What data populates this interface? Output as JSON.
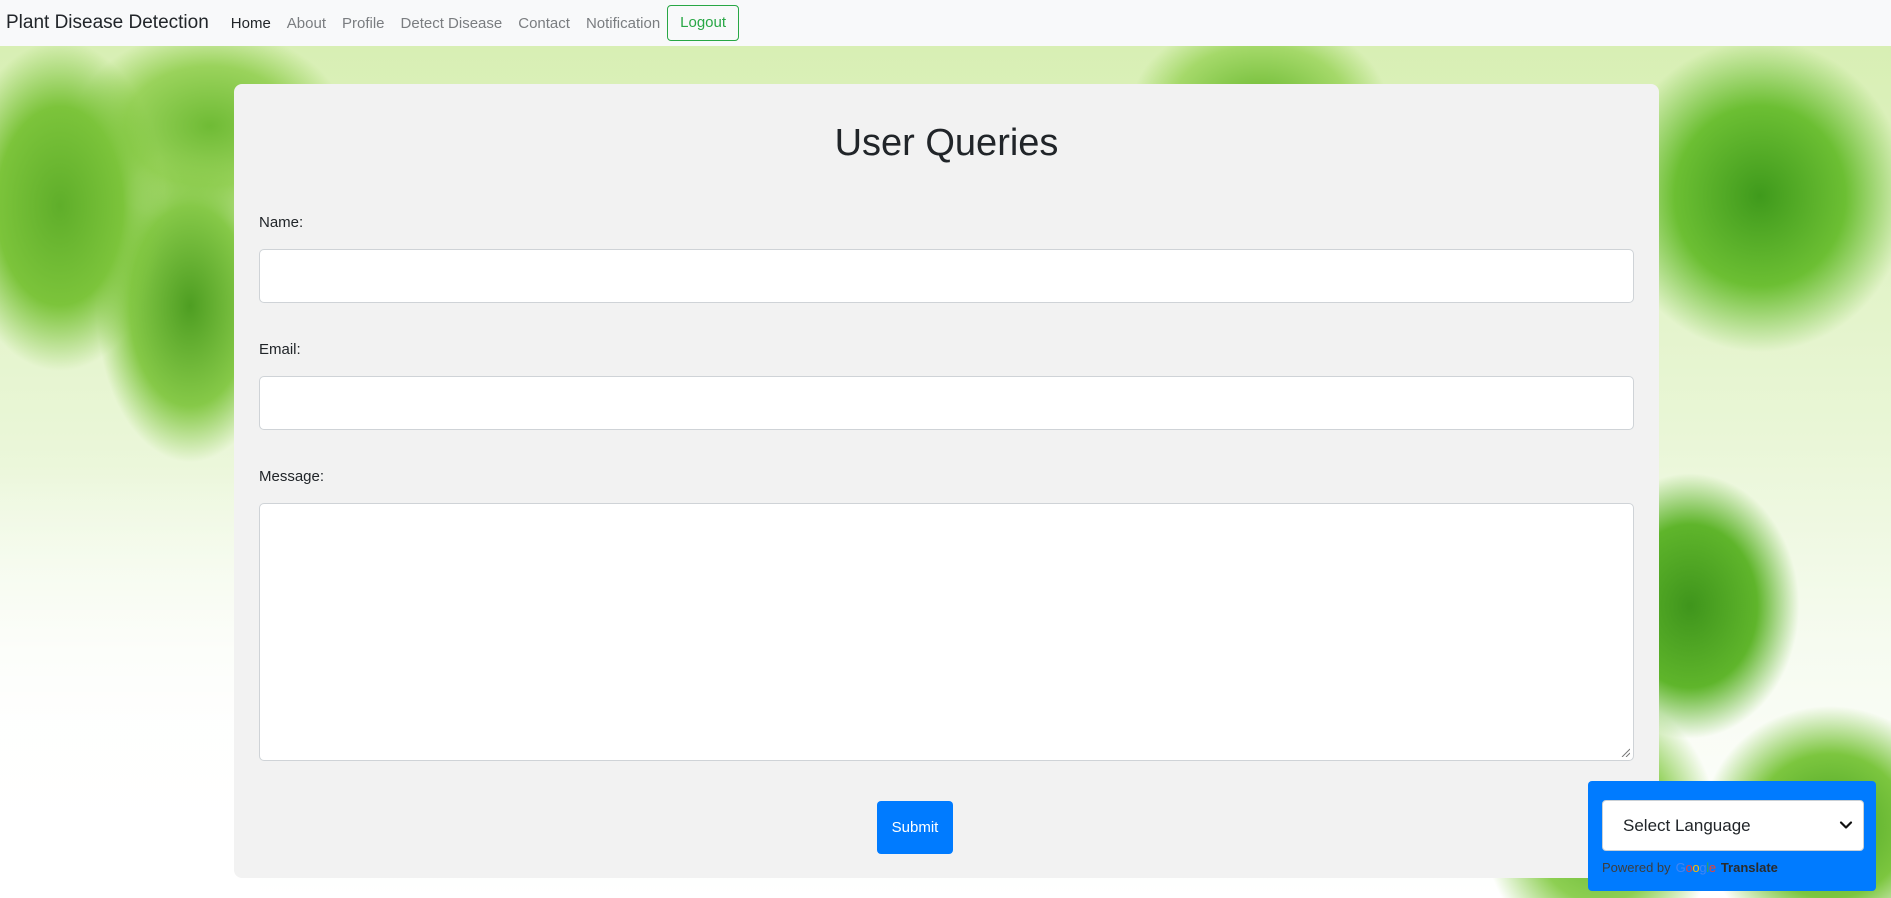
{
  "navbar": {
    "brand": "Plant Disease Detection",
    "links": [
      "Home",
      "About",
      "Profile",
      "Detect Disease",
      "Contact",
      "Notification"
    ],
    "logout": "Logout"
  },
  "form": {
    "title": "User Queries",
    "name_label": "Name:",
    "name_value": "",
    "email_label": "Email:",
    "email_value": "",
    "message_label": "Message:",
    "message_value": "",
    "submit": "Submit"
  },
  "translate": {
    "select_value": "Select Language",
    "powered_by": "Powered by",
    "google": "Google",
    "translate": "Translate"
  },
  "colors": {
    "accent": "#007bff",
    "logout": "#28a745",
    "card": "#f2f2f2"
  },
  "icons": {
    "dropdown": "chevron-down-icon",
    "google_logo": "google-logo-icon"
  }
}
